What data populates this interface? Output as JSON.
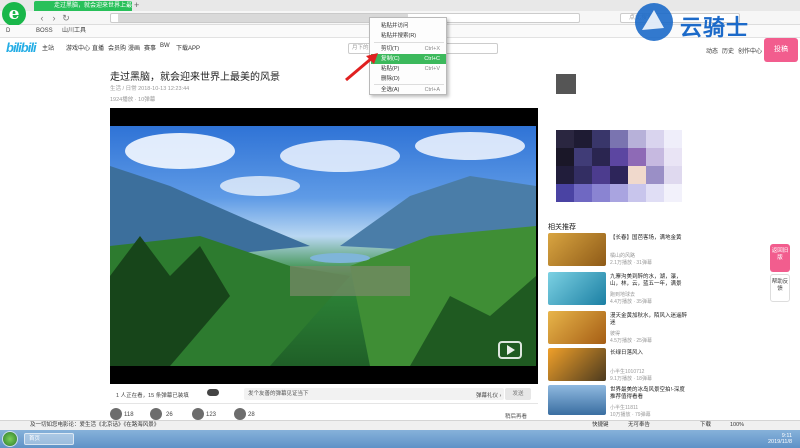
{
  "browser": {
    "tab_title": "走过黑脑，就会迎来世界上最美的",
    "tab_add": "+",
    "back": "‹",
    "forward": "›",
    "reload": "↻",
    "search_placeholder": "点此搜索",
    "bookmarks": [
      "D",
      "BOSS",
      "山川工具"
    ]
  },
  "context_menu": {
    "items": [
      {
        "label": "粘贴并访问",
        "key": ""
      },
      {
        "label": "粘贴并搜索(R)",
        "key": ""
      },
      {
        "label": "剪切(T)",
        "key": "Ctrl+X"
      },
      {
        "label": "复制(C)",
        "key": "Ctrl+C"
      },
      {
        "label": "粘贴(P)",
        "key": "Ctrl+V"
      },
      {
        "label": "删除(D)",
        "key": ""
      },
      {
        "label": "全选(A)",
        "key": "Ctrl+A"
      }
    ],
    "highlighted_index": 3,
    "highlight_color": "#3cb95c"
  },
  "site": {
    "logo": "bilibili",
    "nav": [
      "主站",
      "游戏中心",
      "直播",
      "会员购",
      "漫画",
      "赛事",
      "BW",
      "下载APP"
    ],
    "search_placeholder": "月下的黑奴",
    "header_right": [
      "动态",
      "历史",
      "创作中心"
    ],
    "upload_label": "投稿",
    "brand_color": "#f25d8e"
  },
  "video": {
    "title": "走过黑脑，就会迎来世界上最美的风景",
    "meta": "生活 / 日常     2018-10-13 12:23:44",
    "stats": "1924播放 · 10弹幕",
    "danmaku_count": "1 人正在看，15 条弹幕已装填",
    "danmaku_placeholder": "发个友善的弹幕见证当下",
    "danmaku_tools": "弹幕礼仪 ›",
    "send_label": "发送",
    "likes": "118",
    "coins": "26",
    "favorites": "123",
    "shares": "28",
    "share_text": "稍后再看"
  },
  "related": {
    "title": "相关推荐",
    "items": [
      {
        "title": "【长春】国芭客场，满地金黄",
        "up": "橘山的风路",
        "plays": "2.1万播放 · 31弹幕"
      },
      {
        "title": "九寨沟美到醉的水，湖，瀑，山，林，云，蓝五一年，满景",
        "up": "跑到地球去",
        "plays": "4.4万播放 · 35弹幕"
      },
      {
        "title": "漫天金黄加秋水，陌风入迷遥醉迷",
        "up": "彼得",
        "plays": "4.5万播放 · 25弹幕"
      },
      {
        "title": "长绿日落风入",
        "up": "小半生1010712",
        "plays": "9.1万播放 · 18弹幕"
      },
      {
        "title": "世界最美的冰岛风景空拍!-深度推荐值得看看",
        "up": "小半生11811",
        "plays": "10万播放 · 79弹幕"
      }
    ]
  },
  "side_buttons": [
    "返回旧版",
    "帮助反馈"
  ],
  "statusbar": {
    "text": "及一切如您电影论：爱生活《北京话》《在路海风景》",
    "right": [
      "快捷键",
      "无可奉告",
      "下载",
      "100%"
    ]
  },
  "taskbar": {
    "items": [
      "首页"
    ],
    "time": "9:11",
    "date": "2019/11/8"
  },
  "watermark": "云骑士"
}
